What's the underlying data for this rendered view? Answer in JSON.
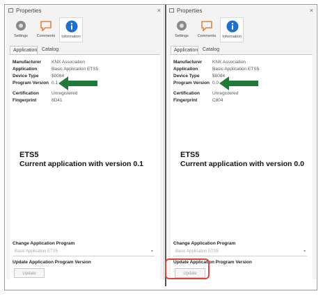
{
  "colors": {
    "arrow": "#1f7a3a",
    "highlight": "#e0453a",
    "info_icon": "#1f6fd0",
    "comment_icon": "#e8833a"
  },
  "left": {
    "title": "Properties",
    "close": "×",
    "tools": [
      "Settings",
      "Comments",
      "Information"
    ],
    "tabs": [
      "Application",
      "Catalog"
    ],
    "props": [
      {
        "key": "Manufacturer",
        "value": "KNX Association"
      },
      {
        "key": "Application",
        "value": "Basic Application ETS5"
      },
      {
        "key": "Device Type",
        "value": "$0084"
      },
      {
        "key": "Program Version",
        "value": "0.1"
      },
      {
        "key": "Certification",
        "value": "Unregistered"
      },
      {
        "key": "Fingerprint",
        "value": "8D41"
      }
    ],
    "heading_line1": "ETS5",
    "heading_line2": "Current application with version 0.1",
    "change_label": "Change Application Program",
    "change_value": "Basic Application ETS5",
    "update_label": "Update Application Program Version",
    "update_button": "Update"
  },
  "right": {
    "title": "Properties",
    "close": "×",
    "tools": [
      "Settings",
      "Comments",
      "Information"
    ],
    "tabs": [
      "Application",
      "Catalog"
    ],
    "props": [
      {
        "key": "Manufacturer",
        "value": "KNX Association"
      },
      {
        "key": "Application",
        "value": "Basic Application ETS5"
      },
      {
        "key": "Device Type",
        "value": "$0084"
      },
      {
        "key": "Program Version",
        "value": "0.0"
      },
      {
        "key": "Certification",
        "value": "Unregistered"
      },
      {
        "key": "Fingerprint",
        "value": "C804"
      }
    ],
    "heading_line1": "ETS5",
    "heading_line2": "Current application with version 0.0",
    "change_label": "Change Application Program",
    "change_value": "Basic Application ETS5",
    "update_label": "Update Application Program Version",
    "update_button": "Update"
  }
}
